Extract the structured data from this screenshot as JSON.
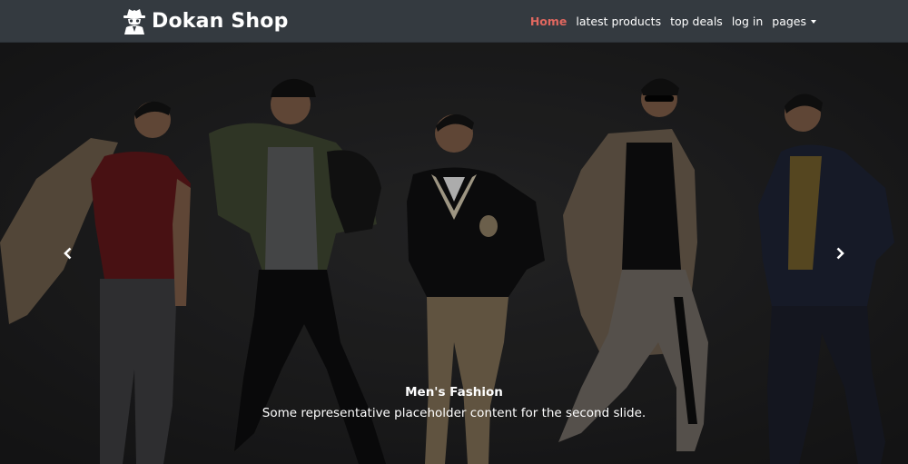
{
  "brand": {
    "name": "Dokan Shop",
    "icon": "spy-icon"
  },
  "nav": {
    "items": [
      {
        "label": "Home",
        "active": true
      },
      {
        "label": "latest products",
        "active": false
      },
      {
        "label": "top deals",
        "active": false
      },
      {
        "label": "log in",
        "active": false
      },
      {
        "label": "pages",
        "active": false,
        "dropdown": true
      }
    ]
  },
  "carousel": {
    "caption_title": "Men's Fashion",
    "caption_text": "Some representative placeholder content for the second slide.",
    "prev_icon": "chevron-left-icon",
    "next_icon": "chevron-right-icon"
  },
  "colors": {
    "navbar": "#343a40",
    "active_link": "#e0675f",
    "background": "#1e1e1f"
  }
}
